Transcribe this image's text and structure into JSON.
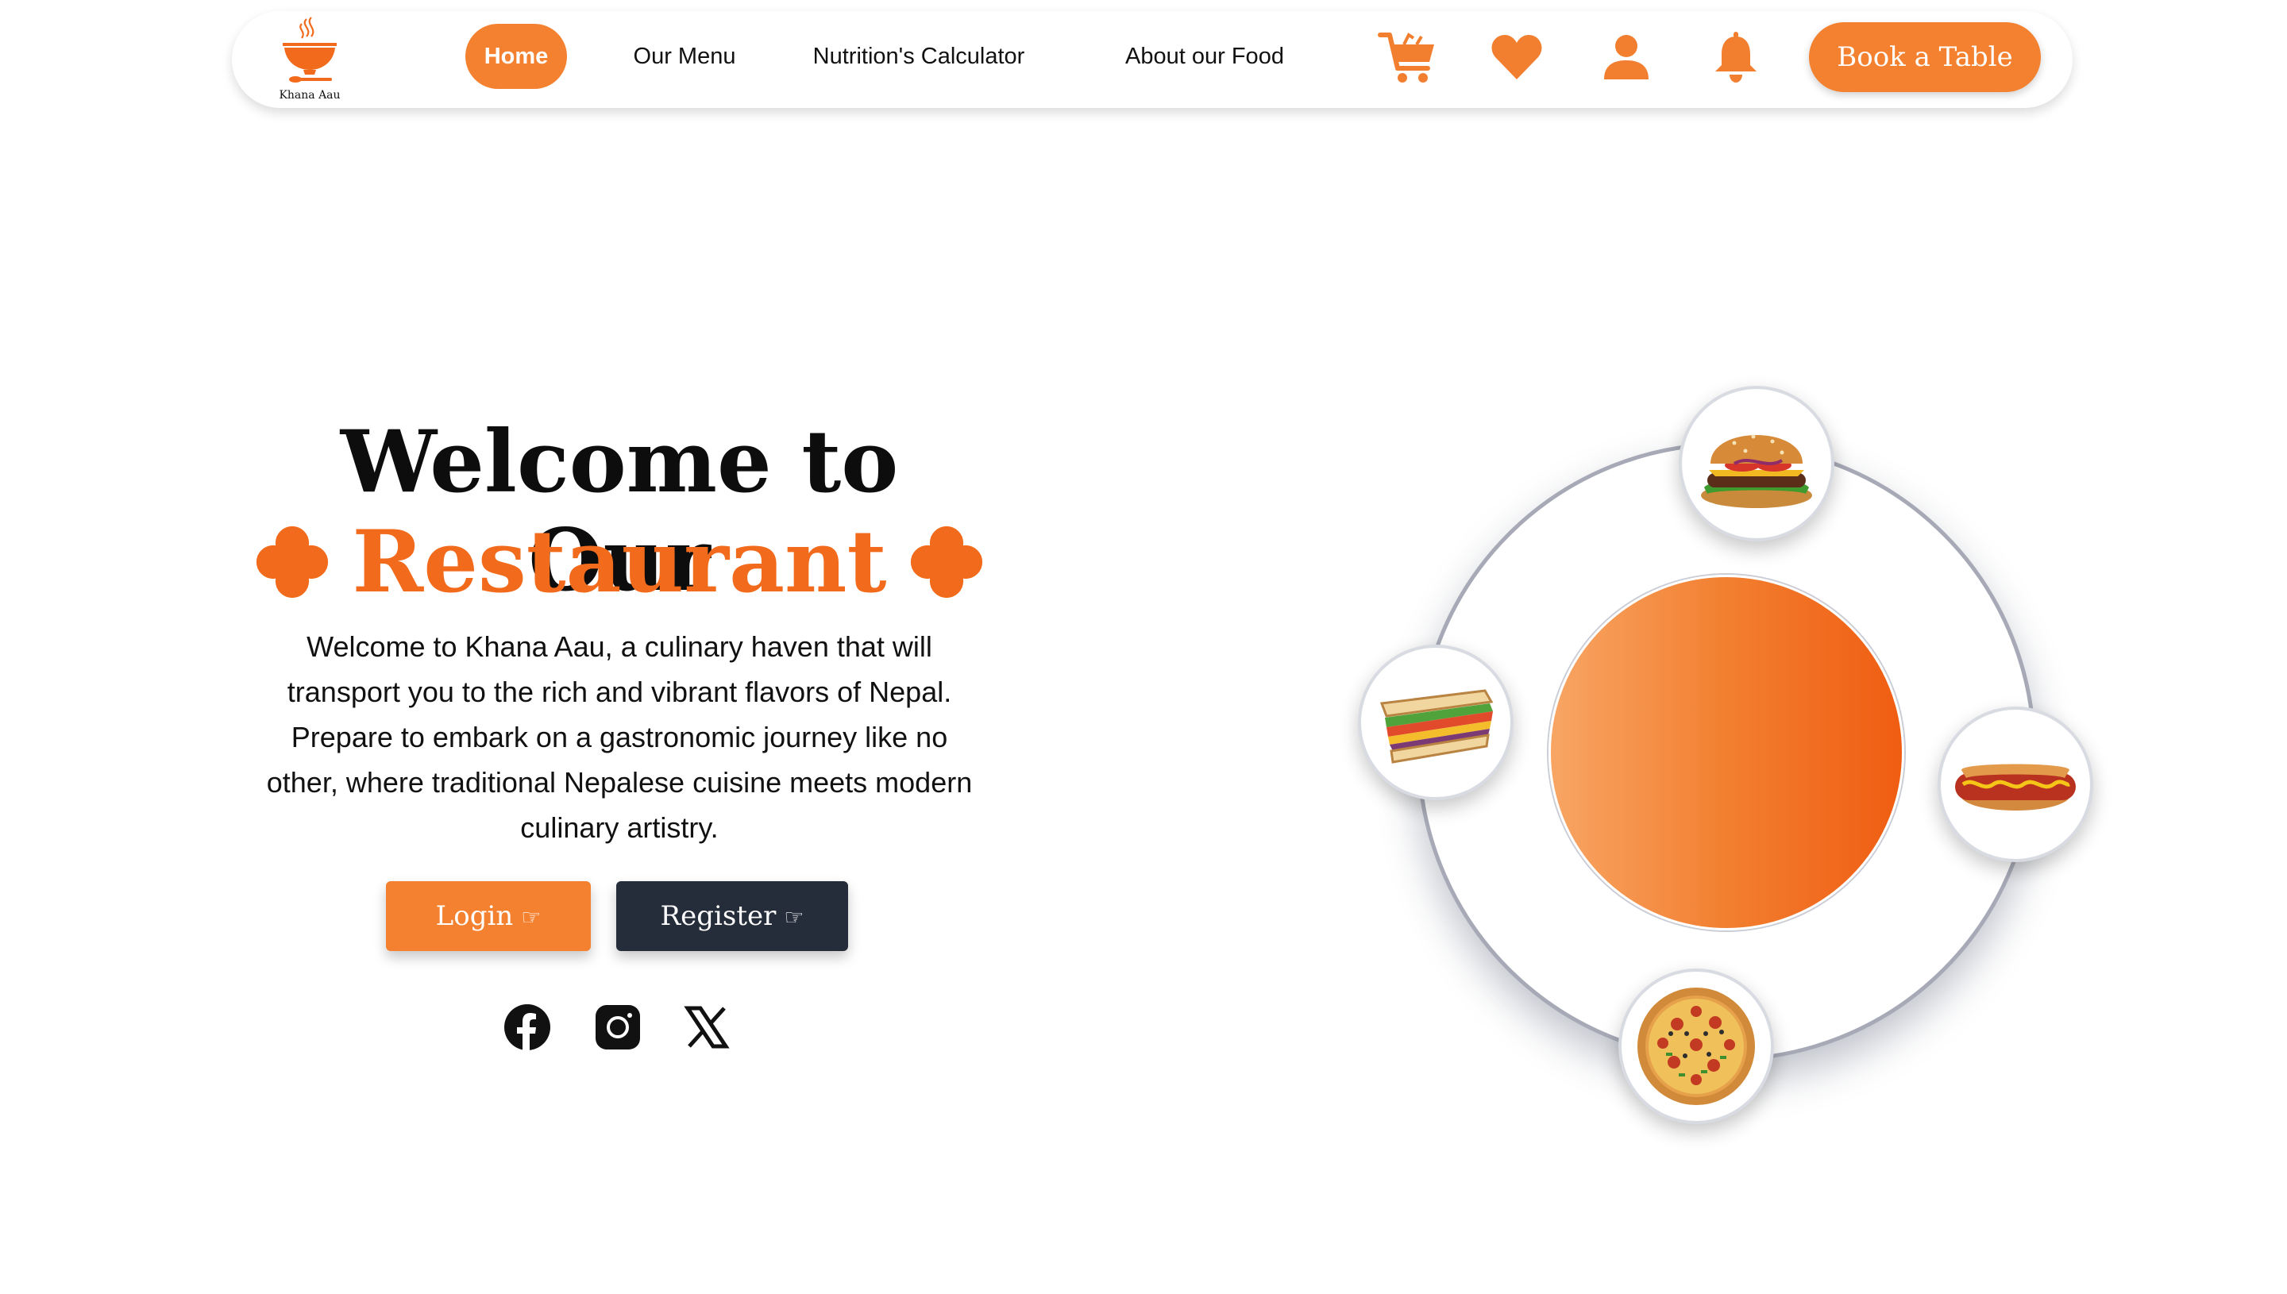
{
  "brand": {
    "name": "Khana Aau",
    "accent": "#f4812f",
    "accent_dark": "#f26a1b",
    "dark": "#252c3a"
  },
  "nav": {
    "links": [
      "Home",
      "Our Menu",
      "Nutrition's Calculator",
      "About our Food"
    ],
    "active": "Home",
    "icons": [
      "cart-icon",
      "heart-icon",
      "user-icon",
      "bell-icon"
    ],
    "cta": "Book a Table"
  },
  "hero": {
    "title": "Welcome to Our",
    "subtitle": "Restaurant",
    "description": "Welcome to Khana Aau, a culinary haven that will transport you to the rich and vibrant flavors of Nepal. Prepare to embark on a gastronomic journey like no other, where traditional Nepalese cuisine meets modern culinary artistry.",
    "buttons": {
      "login": "Login",
      "register": "Register",
      "hand": "☞"
    },
    "social": [
      "facebook-icon",
      "instagram-icon",
      "x-icon"
    ]
  },
  "showcase": {
    "dishes": [
      "burger",
      "sandwich",
      "hotdog",
      "pizza"
    ]
  }
}
